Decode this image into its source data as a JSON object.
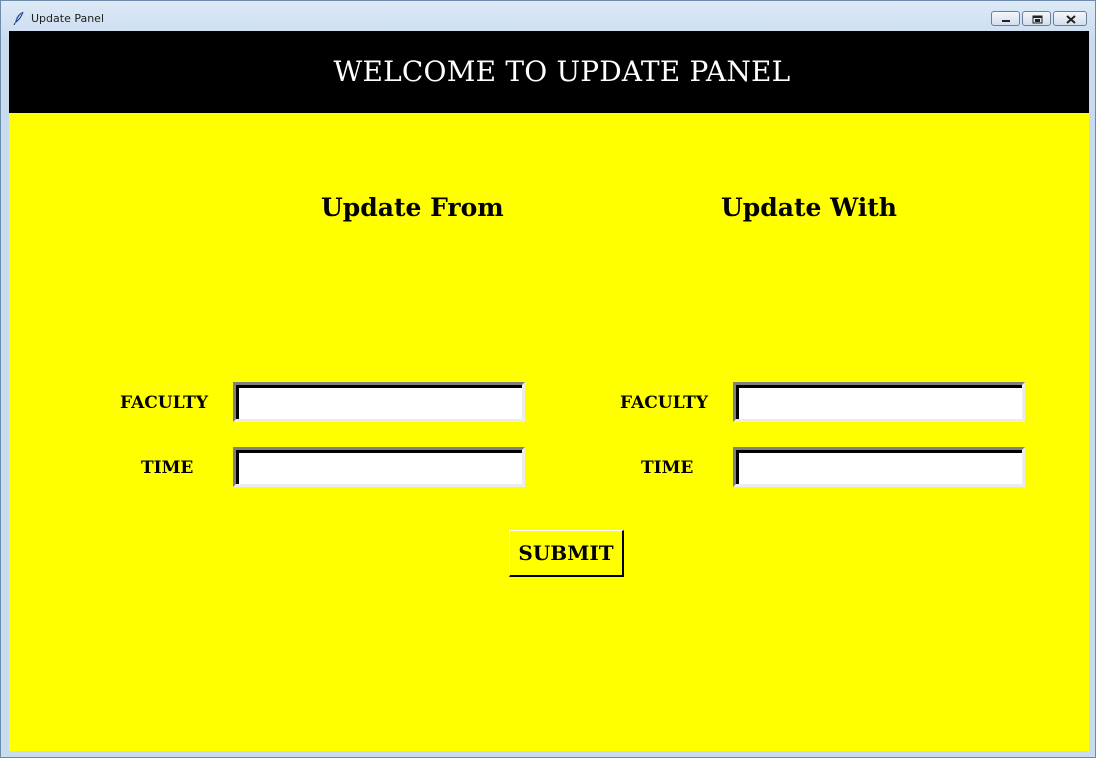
{
  "window": {
    "title": "Update Panel",
    "icon": "feather-icon",
    "controls": {
      "minimize_icon": "minimize-icon",
      "maximize_icon": "restore-icon",
      "close_icon": "close-icon"
    }
  },
  "header": {
    "title": "WELCOME TO UPDATE PANEL"
  },
  "update_from": {
    "heading": "Update From",
    "faculty_label": "FACULTY",
    "faculty_value": "",
    "time_label": "TIME",
    "time_value": ""
  },
  "update_with": {
    "heading": "Update With",
    "faculty_label": "FACULTY",
    "faculty_value": "",
    "time_label": "TIME",
    "time_value": ""
  },
  "submit_label": "SUBMIT",
  "colors": {
    "background": "#ffff00",
    "header_background": "#000000",
    "header_text": "#ffffff"
  }
}
